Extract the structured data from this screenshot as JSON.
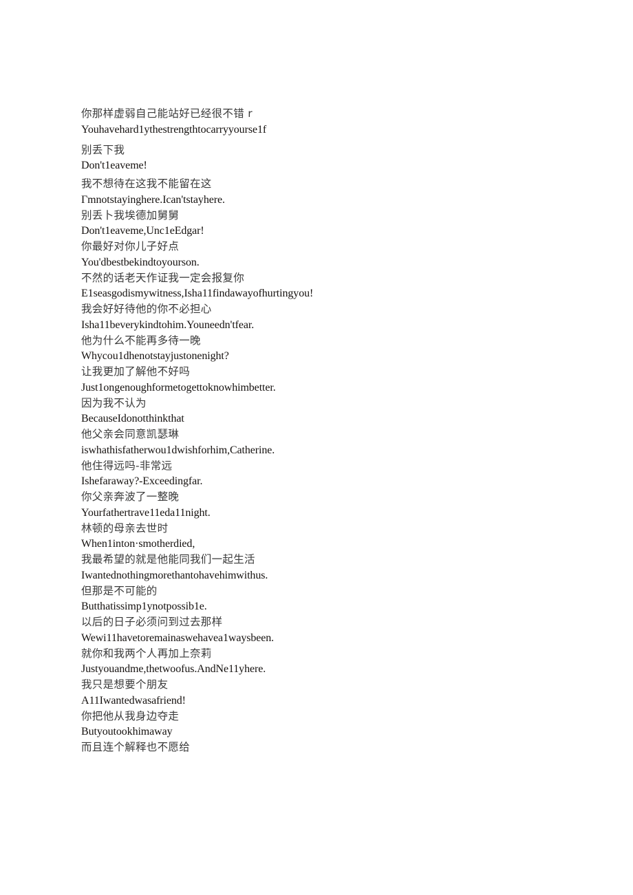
{
  "document": {
    "background_color": "#ffffff",
    "zh_text_color": "#3a3a3a",
    "en_text_color": "#15110f",
    "lines": [
      {
        "id": "l1",
        "lang": "zh",
        "text": "你那样虚弱自己能站好已经很不错 r"
      },
      {
        "id": "l2",
        "lang": "en",
        "text": "Youhavehard1ythestrengthtocarryyourse1f"
      },
      {
        "id": "l3",
        "lang": "zh",
        "text": "别丢下我"
      },
      {
        "id": "l4",
        "lang": "en",
        "text": "Don't1eaveme!"
      },
      {
        "id": "l5",
        "lang": "zh",
        "text": "我不想待在这我不能留在这"
      },
      {
        "id": "l6",
        "lang": "en",
        "text": "Γmnotstayinghere.Ican'tstayhere."
      },
      {
        "id": "l7",
        "lang": "zh",
        "text": "别丢卜我埃德加舅舅"
      },
      {
        "id": "l8",
        "lang": "en",
        "text": "Don't1eaveme,Unc1eEdgar!"
      },
      {
        "id": "l9",
        "lang": "zh",
        "text": "你最好对你儿子好点"
      },
      {
        "id": "l10",
        "lang": "en",
        "text": "You'dbestbekindtoyourson."
      },
      {
        "id": "l11",
        "lang": "zh",
        "text": "不然的话老天作证我一定会报复你"
      },
      {
        "id": "l12",
        "lang": "en",
        "text": "E1seasgodismywitness,Isha11findawayofhurtingyou!"
      },
      {
        "id": "l13",
        "lang": "zh",
        "text": "我会好好待他的你不必担心"
      },
      {
        "id": "l14",
        "lang": "en",
        "text": "Isha11beverykindtohim.Youneedn'tfear."
      },
      {
        "id": "l15",
        "lang": "zh",
        "text": "他为什么不能再多待一晚"
      },
      {
        "id": "l16",
        "lang": "en",
        "text": "Whycou1dhenotstayjustonenight?"
      },
      {
        "id": "l17",
        "lang": "zh",
        "text": "让我更加了解他不好吗"
      },
      {
        "id": "l18",
        "lang": "en",
        "text": "Just1ongenoughformetogettoknowhimbetter."
      },
      {
        "id": "l19",
        "lang": "zh",
        "text": "因为我不认为"
      },
      {
        "id": "l20",
        "lang": "en",
        "text": "BecauseIdonotthinkthat"
      },
      {
        "id": "l21",
        "lang": "zh",
        "text": "他父亲会同意凯瑟琳"
      },
      {
        "id": "l22",
        "lang": "en",
        "text": "iswhathisfatherwou1dwishforhim,Catherine."
      },
      {
        "id": "l23",
        "lang": "zh",
        "text": "他住得远吗-非常远"
      },
      {
        "id": "l24",
        "lang": "en",
        "text": "Ishefaraway?-Exceedingfar."
      },
      {
        "id": "l25",
        "lang": "zh",
        "text": "你父亲奔波了一整晚"
      },
      {
        "id": "l26",
        "lang": "en",
        "text": "Yourfathertrave11eda11night."
      },
      {
        "id": "l27",
        "lang": "zh",
        "text": "林顿的母亲去世时"
      },
      {
        "id": "l28",
        "lang": "en",
        "text": "When1inton·smotherdied,"
      },
      {
        "id": "l29",
        "lang": "zh",
        "text": "我最希望的就是他能同我们一起生活"
      },
      {
        "id": "l30",
        "lang": "en",
        "text": "Iwantednothingmorethantohavehimwithus."
      },
      {
        "id": "l31",
        "lang": "zh",
        "text": "但那是不可能的"
      },
      {
        "id": "l32",
        "lang": "en",
        "text": "Butthatissimp1ynotpossib1e."
      },
      {
        "id": "l33",
        "lang": "zh",
        "text": "以后的日子必须问到过去那样"
      },
      {
        "id": "l34",
        "lang": "en",
        "text": "Wewi11havetoremainaswehavea1waysbeen."
      },
      {
        "id": "l35",
        "lang": "zh",
        "text": "就你和我两个人再加上奈莉"
      },
      {
        "id": "l36",
        "lang": "en",
        "text": "Justyouandme,thetwoofus.AndNe11yhere."
      },
      {
        "id": "l37",
        "lang": "zh",
        "text": "我只是想要个朋友"
      },
      {
        "id": "l38",
        "lang": "en",
        "text": "A11Iwantedwasafriend!"
      },
      {
        "id": "l39",
        "lang": "zh",
        "text": "你把他从我身边夺走"
      },
      {
        "id": "l40",
        "lang": "en",
        "text": "Butyoutookhimaway"
      },
      {
        "id": "l41",
        "lang": "zh",
        "text": "而且连个解释也不愿给"
      }
    ]
  }
}
